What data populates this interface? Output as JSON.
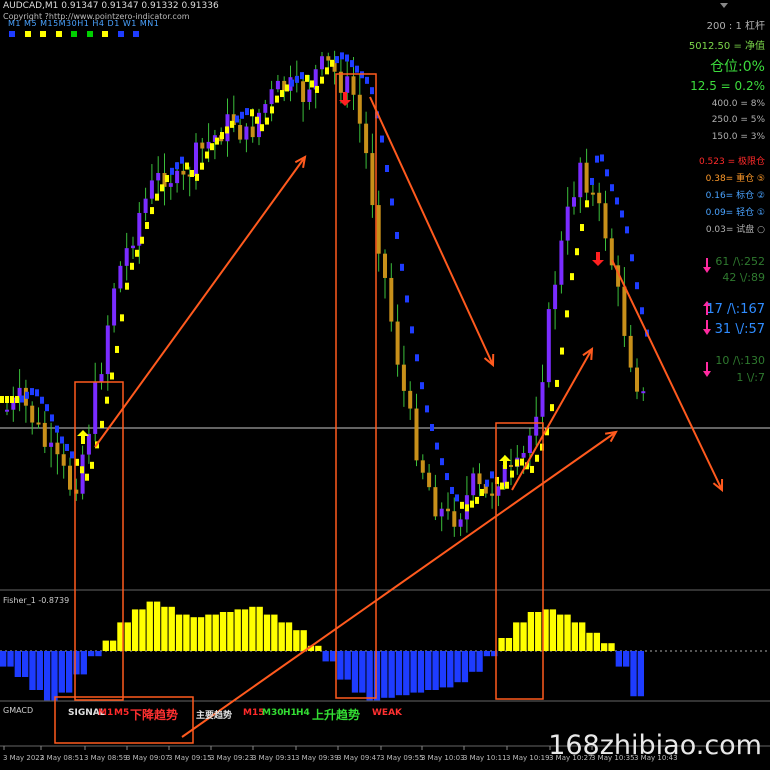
{
  "header": {
    "symbol_line": "AUDCAD,M1  0.91347 0.91347 0.91332 0.91336",
    "copyright": "Copyright ?http://www.pointzero-indicator.com",
    "timeframes": "M1 M5 M15M30H1 H4 D1 W1 MN1"
  },
  "tf_squares": [
    "#1e3cff",
    "#ffff00",
    "#ffff00",
    "#ffff00",
    "#00d000",
    "#00d000",
    "#ffff00",
    "#1e3cff",
    "#1e3cff"
  ],
  "right_panel": [
    {
      "text": "200 : 1  杠杆",
      "color": "#b0b0b0"
    },
    {
      "text": "5012.50 = 净值",
      "color": "#7cd84a"
    },
    {
      "text": "仓位:0%",
      "color": "#3ddc3d"
    },
    {
      "text": "12.5 = 0.2%",
      "color": "#3ddc3d"
    },
    {
      "text": "400.0 = 8%",
      "color": "#b0b0b0"
    },
    {
      "text": "250.0 = 5%",
      "color": "#b0b0b0"
    },
    {
      "text": "150.0 = 3%",
      "color": "#b0b0b0"
    },
    {
      "text": "0.523 =  极限仓",
      "color": "#ff2a2a"
    },
    {
      "text": "0.38= 重仓 ⑤",
      "color": "#ff9a2a"
    },
    {
      "text": "0.16= 标仓 ②",
      "color": "#4aa3ff"
    },
    {
      "text": "0.09= 轻仓 ①",
      "color": "#4aa3ff"
    },
    {
      "text": "0.03= 试盘 ○",
      "color": "#b0b0b0"
    },
    {
      "text": "61 /\\:252",
      "color": "#2f7a2f"
    },
    {
      "text": "42 \\/:89",
      "color": "#2f7a2f"
    },
    {
      "text": "17 /\\:167",
      "color": "#2f8cff"
    },
    {
      "text": "31 \\/:57",
      "color": "#2f8cff"
    },
    {
      "text": "10 /\\:130",
      "color": "#2f7a2f"
    },
    {
      "text": "1 \\/:7",
      "color": "#2f7a2f"
    }
  ],
  "fisher_label": "Fisher_1 -0.8739",
  "gmacd_label": "GMACD",
  "signal_row": [
    {
      "text": "SIGNAL",
      "color": "#e0e0e0"
    },
    {
      "text": "M1",
      "color": "#ff2a2a"
    },
    {
      "text": "M5",
      "color": "#ff2a2a"
    },
    {
      "text": "下降趋势",
      "color": "#ff3030"
    },
    {
      "text": "主要趋势",
      "color": "#e0e0e0"
    },
    {
      "text": "M15",
      "color": "#ff2a2a"
    },
    {
      "text": "M30",
      "color": "#33dd33"
    },
    {
      "text": "H1",
      "color": "#33dd33"
    },
    {
      "text": "H4",
      "color": "#33dd33"
    },
    {
      "text": "上升趋势",
      "color": "#33dd33"
    },
    {
      "text": "WEAK",
      "color": "#ff3030"
    }
  ],
  "watermark": "168zhibiao.com",
  "chart_data": {
    "type": "candlestick",
    "x_ticks": [
      "3 May 2022",
      "3 May 08:51",
      "3 May 08:59",
      "3 May 09:07",
      "3 May 09:15",
      "3 May 09:23",
      "3 May 09:31",
      "3 May 09:39",
      "3 May 09:47",
      "3 May 09:55",
      "3 May 10:03",
      "3 May 10:11",
      "3 May 10:19",
      "3 May 10:27",
      "3 May 10:35",
      "3 May 10:43"
    ],
    "close_path": [
      0.3,
      0.32,
      0.28,
      0.22,
      0.18,
      0.14,
      0.25,
      0.38,
      0.55,
      0.62,
      0.7,
      0.75,
      0.78,
      0.74,
      0.8,
      0.83,
      0.86,
      0.88,
      0.84,
      0.9,
      0.93,
      0.95,
      0.92,
      0.97,
      0.99,
      0.96,
      0.93,
      0.8,
      0.62,
      0.45,
      0.3,
      0.2,
      0.12,
      0.08,
      0.1,
      0.15,
      0.12,
      0.18,
      0.16,
      0.22,
      0.35,
      0.55,
      0.68,
      0.8,
      0.72,
      0.65,
      0.5,
      0.38,
      0.3
    ],
    "indicator_colors": {
      "up": "#ffff00",
      "down": "#1e3cff"
    },
    "fisher_values": [
      -0.3,
      -0.5,
      -0.75,
      -0.95,
      -0.8,
      -0.45,
      -0.1,
      0.2,
      0.55,
      0.8,
      0.95,
      0.85,
      0.7,
      0.65,
      0.7,
      0.75,
      0.8,
      0.85,
      0.7,
      0.55,
      0.4,
      0.1,
      -0.2,
      -0.55,
      -0.8,
      -0.95,
      -0.9,
      -0.85,
      -0.8,
      -0.75,
      -0.7,
      -0.6,
      -0.4,
      -0.1,
      0.25,
      0.55,
      0.75,
      0.8,
      0.7,
      0.55,
      0.35,
      0.15,
      -0.3,
      -0.87
    ]
  }
}
